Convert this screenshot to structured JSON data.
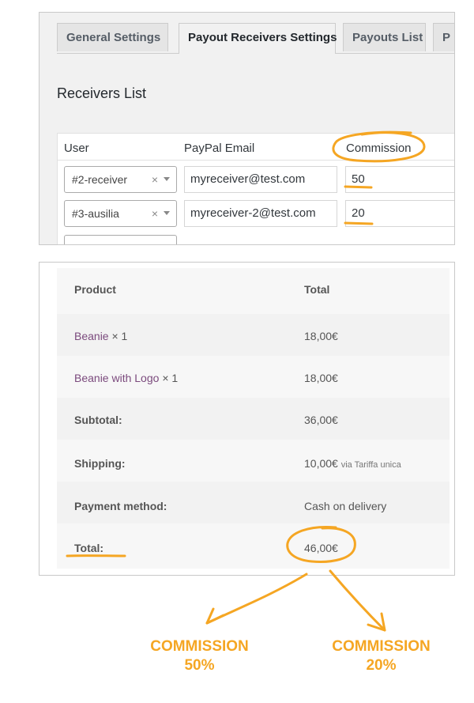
{
  "tabs": [
    {
      "label": "General Settings"
    },
    {
      "label": "Payout Receivers Settings"
    },
    {
      "label": "Payouts List"
    },
    {
      "label": "P"
    }
  ],
  "receivers": {
    "title": "Receivers List",
    "headers": {
      "user": "User",
      "email": "PayPal Email",
      "commission": "Commission"
    },
    "rows": [
      {
        "user": "#2-receiver",
        "email": "myreceiver@test.com",
        "commission": "50"
      },
      {
        "user": "#3-ausilia",
        "email": "myreceiver-2@test.com",
        "commission": "20"
      }
    ],
    "clear_symbol": "×"
  },
  "order": {
    "headers": {
      "product": "Product",
      "total": "Total"
    },
    "items": [
      {
        "name": "Beanie",
        "qty": "× 1",
        "total": "18,00€"
      },
      {
        "name": "Beanie with Logo",
        "qty": "× 1",
        "total": "18,00€"
      }
    ],
    "subtotal": {
      "label": "Subtotal:",
      "value": "36,00€"
    },
    "shipping": {
      "label": "Shipping:",
      "value": "10,00€",
      "note": "via Tariffa unica"
    },
    "payment": {
      "label": "Payment method:",
      "value": "Cash on delivery"
    },
    "total": {
      "label": "Total:",
      "value": "46,00€"
    }
  },
  "annotations": {
    "commission_1": {
      "line1": "COMMISSION",
      "line2": "50%"
    },
    "commission_2": {
      "line1": "COMMISSION",
      "line2": "20%"
    },
    "accent_color": "#f5a623"
  }
}
